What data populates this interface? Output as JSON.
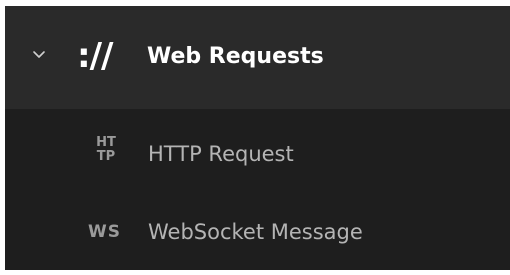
{
  "group": {
    "chevron_icon": "chevron-down-icon",
    "icon_text": "://",
    "label": "Web Requests"
  },
  "items": [
    {
      "icon_line1": "HT",
      "icon_line2": "TP",
      "label": "HTTP Request"
    },
    {
      "icon_text": "WS",
      "label": "WebSocket Message"
    }
  ],
  "colors": {
    "background": "#1e1e1e",
    "header_background": "#2a2a2a",
    "header_text": "#ffffff",
    "item_text": "#b4b4b4",
    "icon_text": "#9a9a9a"
  }
}
